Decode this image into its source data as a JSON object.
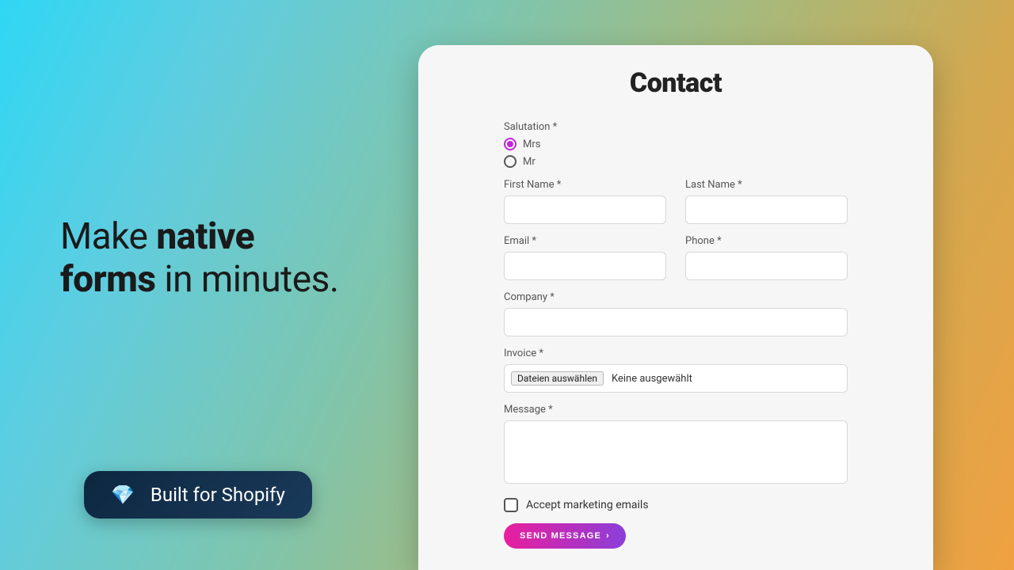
{
  "headline": {
    "pre": "Make ",
    "bold1": "native",
    "mid_break": "forms",
    "post": " in minutes."
  },
  "badge": {
    "icon": "💎",
    "text": "Built for Shopify"
  },
  "card": {
    "title": "Contact"
  },
  "form": {
    "salutation_label": "Salutation *",
    "salutation_options": {
      "mrs": "Mrs",
      "mr": "Mr"
    },
    "first_name_label": "First Name *",
    "last_name_label": "Last Name *",
    "email_label": "Email *",
    "phone_label": "Phone *",
    "company_label": "Company *",
    "invoice_label": "Invoice *",
    "file_button": "Dateien auswählen",
    "file_status": "Keine ausgewählt",
    "message_label": "Message *",
    "accept_label": "Accept marketing emails",
    "send_label": "SEND MESSAGE",
    "send_chevron": "›"
  }
}
